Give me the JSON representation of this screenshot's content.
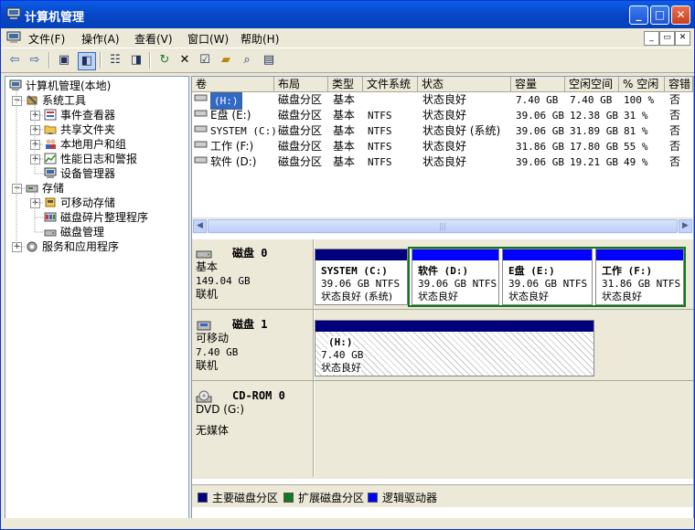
{
  "window": {
    "title": "计算机管理"
  },
  "menu": [
    "文件(F)",
    "操作(A)",
    "查看(V)",
    "窗口(W)",
    "帮助(H)"
  ],
  "tree": {
    "root": "计算机管理(本地)",
    "system_tools": "系统工具",
    "event_viewer": "事件查看器",
    "shared_folders": "共享文件夹",
    "local_users": "本地用户和组",
    "perf_logs": "性能日志和警报",
    "device_manager": "设备管理器",
    "storage": "存储",
    "removable": "可移动存储",
    "defrag": "磁盘碎片整理程序",
    "disk_mgmt": "磁盘管理",
    "services": "服务和应用程序"
  },
  "columns": [
    "卷",
    "布局",
    "类型",
    "文件系统",
    "状态",
    "容量",
    "空闲空间",
    "% 空闲",
    "容错"
  ],
  "volumes": [
    {
      "name": "(H:)",
      "layout": "磁盘分区",
      "type": "基本",
      "fs": "",
      "status": "状态良好",
      "capacity": "7.40 GB",
      "free": "7.40 GB",
      "pct": "100 %",
      "fault": "否"
    },
    {
      "name": "E盘 (E:)",
      "layout": "磁盘分区",
      "type": "基本",
      "fs": "NTFS",
      "status": "状态良好",
      "capacity": "39.06 GB",
      "free": "12.38 GB",
      "pct": "31 %",
      "fault": "否"
    },
    {
      "name": "SYSTEM (C:)",
      "layout": "磁盘分区",
      "type": "基本",
      "fs": "NTFS",
      "status": "状态良好 (系统)",
      "capacity": "39.06 GB",
      "free": "31.89 GB",
      "pct": "81 %",
      "fault": "否"
    },
    {
      "name": "工作 (F:)",
      "layout": "磁盘分区",
      "type": "基本",
      "fs": "NTFS",
      "status": "状态良好",
      "capacity": "31.86 GB",
      "free": "17.80 GB",
      "pct": "55 %",
      "fault": "否"
    },
    {
      "name": "软件 (D:)",
      "layout": "磁盘分区",
      "type": "基本",
      "fs": "NTFS",
      "status": "状态良好",
      "capacity": "39.06 GB",
      "free": "19.21 GB",
      "pct": "49 %",
      "fault": "否"
    }
  ],
  "disks": [
    {
      "name": "磁盘 0",
      "type": "基本",
      "size": "149.04 GB",
      "state": "联机"
    },
    {
      "name": "磁盘 1",
      "type": "可移动",
      "size": "7.40 GB",
      "state": "联机"
    },
    {
      "name": "CD-ROM 0",
      "type": "DVD (G:)",
      "size": "",
      "state": "无媒体"
    }
  ],
  "partitions": [
    {
      "label": "SYSTEM  (C:)",
      "size": "39.06 GB NTFS",
      "status": "状态良好 (系统)"
    },
    {
      "label": "软件  (D:)",
      "size": "39.06 GB NTFS",
      "status": "状态良好"
    },
    {
      "label": "E盘  (E:)",
      "size": "39.06 GB NTFS",
      "status": "状态良好"
    },
    {
      "label": "工作  (F:)",
      "size": "31.86 GB NTFS",
      "status": "状态良好"
    },
    {
      "label": "(H:)",
      "size": "7.40 GB",
      "status": "状态良好"
    }
  ],
  "legend": [
    "主要磁盘分区",
    "扩展磁盘分区",
    "逻辑驱动器"
  ],
  "colors": {
    "primary": "#00007f",
    "extended": "#0f7a1e",
    "logical": "#0000ff",
    "titlebar": "#0a5ee6",
    "selection": "#316ac5"
  },
  "icons": {
    "back": "back-arrow-icon",
    "forward": "forward-arrow-icon",
    "up": "up-folder-icon",
    "show_tree": "show-tree-icon",
    "properties": "properties-icon",
    "help": "help-icon",
    "refresh": "refresh-icon",
    "delete": "delete-icon",
    "connect": "connect-icon",
    "open": "open-folder-icon",
    "find": "find-icon",
    "settings": "settings-icon"
  }
}
